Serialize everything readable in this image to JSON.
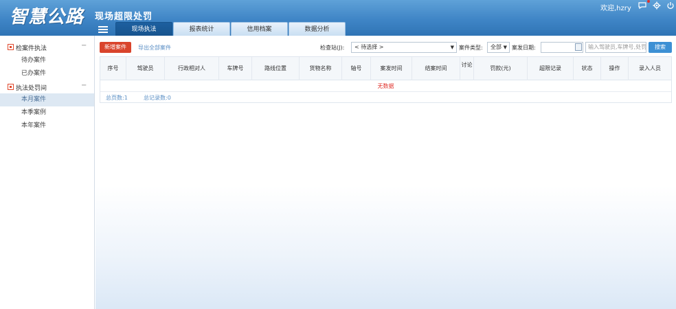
{
  "header": {
    "logo": "智慧公路",
    "subtitle": "现场超限处罚",
    "welcome": "欢迎,hzry",
    "icons": [
      "message-icon",
      "settings-icon",
      "power-icon"
    ]
  },
  "tabs": [
    {
      "label": "现场执法",
      "active": true
    },
    {
      "label": "报表统计",
      "active": false
    },
    {
      "label": "信用档案",
      "active": false
    },
    {
      "label": "数据分析",
      "active": false
    }
  ],
  "sidebar": {
    "group1": {
      "label": "检案件执法"
    },
    "group1_items": [
      "待办案件",
      "已办案件"
    ],
    "group2": {
      "label": "执法处罚间"
    },
    "group2_items": [
      "本月案件",
      "本季案例",
      "本年案件"
    ],
    "active_item": "本月案件"
  },
  "toolbar": {
    "new_button": "新增案件",
    "export_link": "导出全部案件",
    "checkpoint_label": "检查站(J):",
    "checkpoint_value": "< 待选择 >",
    "case_type_label": "案件类型:",
    "case_type_value": "全部",
    "date_label": "案发日期:",
    "date_value": "",
    "search_placeholder": "输入驾驶员,车牌号,处罚人...",
    "search_button": "搜索"
  },
  "table": {
    "headers": [
      "序号",
      "驾驶员",
      "行政相对人",
      "车牌号",
      "路线位置",
      "货物名称",
      "轴号",
      "案发时间",
      "结案时间",
      "讨论",
      "罚款(元)",
      "超限记录",
      "状态",
      "操作",
      "录入人员"
    ],
    "empty_text": "无数据"
  },
  "footer": {
    "total_pages": "总页数:1",
    "total_records": "总记录数:0"
  }
}
